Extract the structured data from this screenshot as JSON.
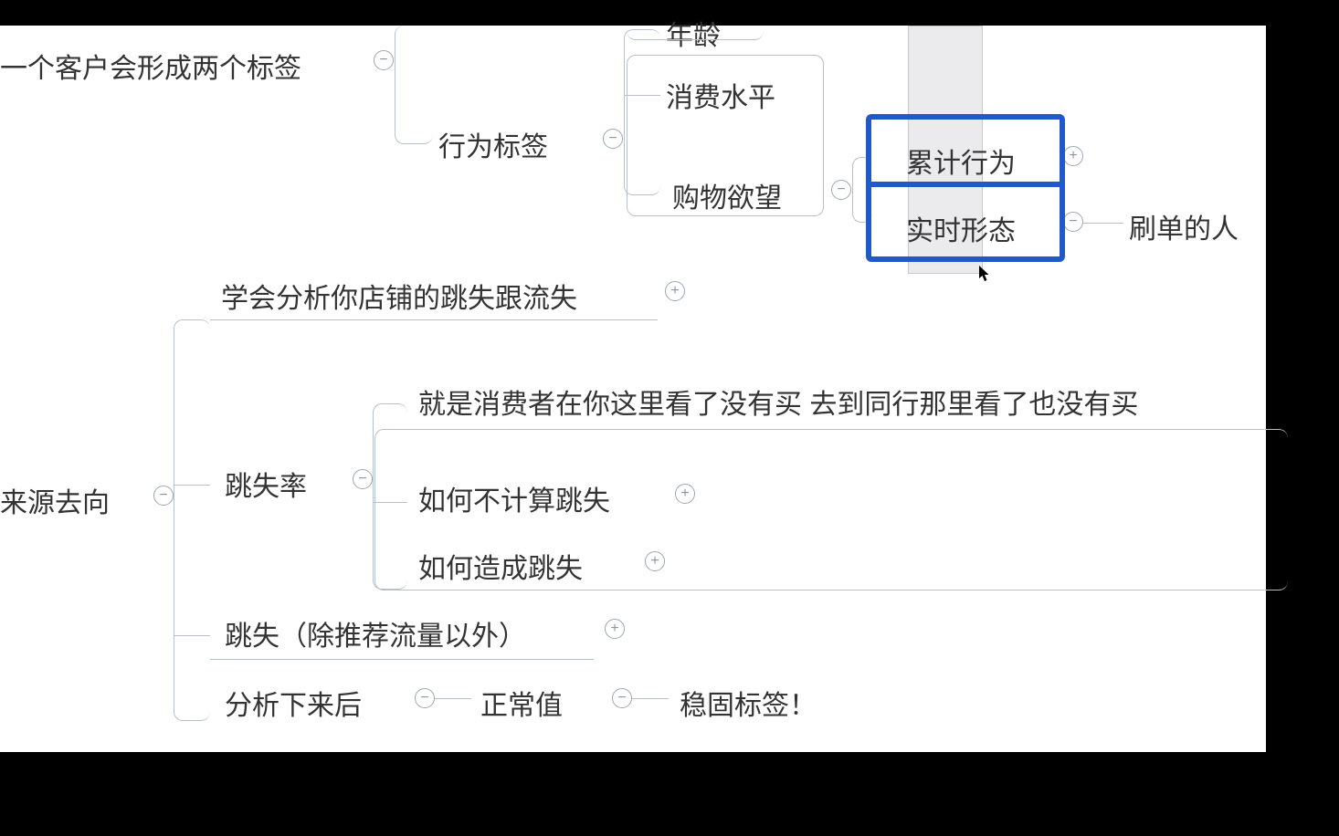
{
  "nodes": {
    "root_labels": "一个客户会形成两个标签",
    "behavior_tag": "行为标签",
    "age_partial": "年龄",
    "consume_level": "消费水平",
    "shopping_desire": "购物欲望",
    "cumulative_behavior": "累计行为",
    "realtime_form": "实时形态",
    "brush_people": "刷单的人",
    "learn_analyze": "学会分析你店铺的跳失跟流失",
    "source_dest": "来源去向",
    "bounce_rate": "跳失率",
    "not_buy_here_or_peer": "就是消费者在你这里看了没有买 去到同行那里看了也没有买",
    "how_not_count_bounce": "如何不计算跳失",
    "how_cause_bounce": "如何造成跳失",
    "bounce_except_rec": "跳失（除推荐流量以外）",
    "after_analyze": "分析下来后",
    "normal_value": "正常值",
    "solid_label": "稳固标签！"
  },
  "icons": {
    "plus": "+",
    "minus": "−"
  }
}
